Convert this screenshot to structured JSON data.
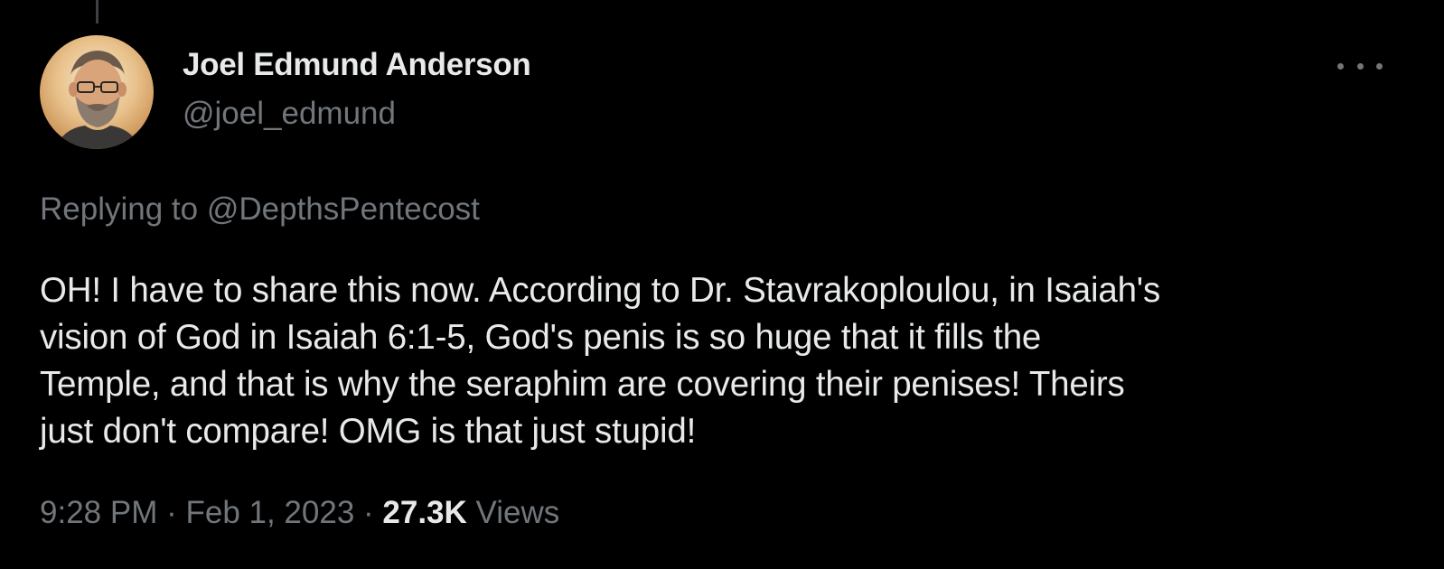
{
  "author": {
    "display_name": "Joel Edmund Anderson",
    "handle": "@joel_edmund",
    "avatar_icon": "user-avatar-portrait"
  },
  "header": {
    "more_icon": "more-horizontal-icon"
  },
  "reply": {
    "prefix": "Replying to ",
    "mention": "@DepthsPentecost"
  },
  "tweet": {
    "text_lines": [
      "OH! I have to share this now. According to Dr. Stavrakoploulou, in Isaiah's",
      "vision of God in Isaiah 6:1-5, God's penis is so huge that it fills the",
      "Temple, and that is why the seraphim are covering their penises! Theirs",
      "just don't compare! OMG is that just stupid!"
    ]
  },
  "meta": {
    "time": "9:28 PM",
    "separator": " · ",
    "date": "Feb 1, 2023",
    "views_count": "27.3K",
    "views_label": " Views"
  },
  "colors": {
    "background": "#000000",
    "primary_text": "#e7e9ea",
    "secondary_text": "#71767b",
    "thread_line": "#3e4144"
  }
}
